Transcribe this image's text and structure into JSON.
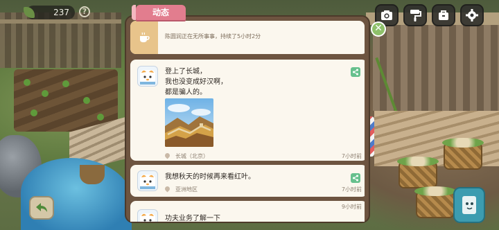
{
  "hud": {
    "currency_count": "237",
    "help_label": "?"
  },
  "panel": {
    "title": "动态",
    "close_label": "✕",
    "status": {
      "text": "陈圆润正在无所事事，持续了5小时2分"
    },
    "posts": [
      {
        "lines": [
          "登上了长城，",
          "我也没变成好汉啊，",
          "都是骗人的。"
        ],
        "location": "长城（北京）",
        "time": "7小时前"
      },
      {
        "lines": [
          "我想秋天的时候再来看红叶。"
        ],
        "location": "亚洲地区",
        "time": "7小时前"
      },
      {
        "lines": [
          "功夫业务了解一下"
        ],
        "time": "9小时前"
      }
    ]
  },
  "icons": {
    "camera": "camera-icon",
    "paint": "paint-roller-icon",
    "bag": "bag-icon",
    "settings": "gear-icon",
    "back": "back-arrow-icon",
    "book": "book-icon"
  },
  "colors": {
    "tab_pink": "#e27d8e",
    "panel_brown": "#6d5440",
    "card_bg": "#fbf7ee",
    "share_green": "#67c08d",
    "close_green": "#8ec06a"
  }
}
